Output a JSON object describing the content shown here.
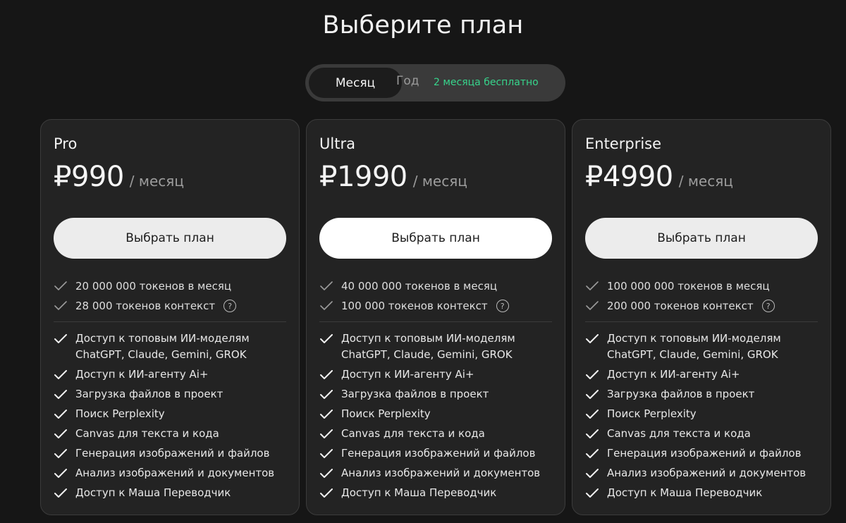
{
  "page": {
    "title": "Выберите план"
  },
  "billing_toggle": {
    "month_label": "Месяц",
    "year_label": "Год",
    "year_promo": "2 месяца бесплатно",
    "selected": "Месяц"
  },
  "colors": {
    "background": "#161616",
    "card": "#232323",
    "promo_green": "#37d58c",
    "button": "#ececec"
  },
  "plans": [
    {
      "name": "Pro",
      "price": "₽990",
      "period": "/ месяц",
      "button_label": "Выбрать план",
      "limits": [
        "20 000 000 токенов в месяц",
        "28 000 токенов контекст"
      ],
      "features": [
        {
          "line1": "Доступ к топовым ИИ-моделям",
          "line2": "ChatGPT, Claude, Gemini, GROK"
        },
        {
          "line1": "Доступ к ИИ-агенту Ai+"
        },
        {
          "line1": "Загрузка файлов в проект"
        },
        {
          "line1": "Поиск Perplexity"
        },
        {
          "line1": "Canvas для текста и кода"
        },
        {
          "line1": "Генерация изображений и файлов"
        },
        {
          "line1": "Анализ изображений и документов"
        },
        {
          "line1": "Доступ к Маша Переводчик"
        }
      ]
    },
    {
      "name": "Ultra",
      "price": "₽1990",
      "period": "/ месяц",
      "button_label": "Выбрать план",
      "limits": [
        "40 000 000 токенов в месяц",
        "100 000 токенов контекст"
      ],
      "features": [
        {
          "line1": "Доступ к топовым ИИ-моделям",
          "line2": "ChatGPT, Claude, Gemini, GROK"
        },
        {
          "line1": "Доступ к ИИ-агенту Ai+"
        },
        {
          "line1": "Загрузка файлов в проект"
        },
        {
          "line1": "Поиск Perplexity"
        },
        {
          "line1": "Canvas для текста и кода"
        },
        {
          "line1": "Генерация изображений и файлов"
        },
        {
          "line1": "Анализ изображений и документов"
        },
        {
          "line1": "Доступ к Маша Переводчик"
        }
      ]
    },
    {
      "name": "Enterprise",
      "price": "₽4990",
      "period": "/ месяц",
      "button_label": "Выбрать план",
      "limits": [
        "100 000 000 токенов в месяц",
        "200 000 токенов контекст"
      ],
      "features": [
        {
          "line1": "Доступ к топовым ИИ-моделям",
          "line2": "ChatGPT, Claude, Gemini, GROK"
        },
        {
          "line1": "Доступ к ИИ-агенту Ai+"
        },
        {
          "line1": "Загрузка файлов в проект"
        },
        {
          "line1": "Поиск Perplexity"
        },
        {
          "line1": "Canvas для текста и кода"
        },
        {
          "line1": "Генерация изображений и файлов"
        },
        {
          "line1": "Анализ изображений и документов"
        },
        {
          "line1": "Доступ к Маша Переводчик"
        }
      ]
    }
  ]
}
